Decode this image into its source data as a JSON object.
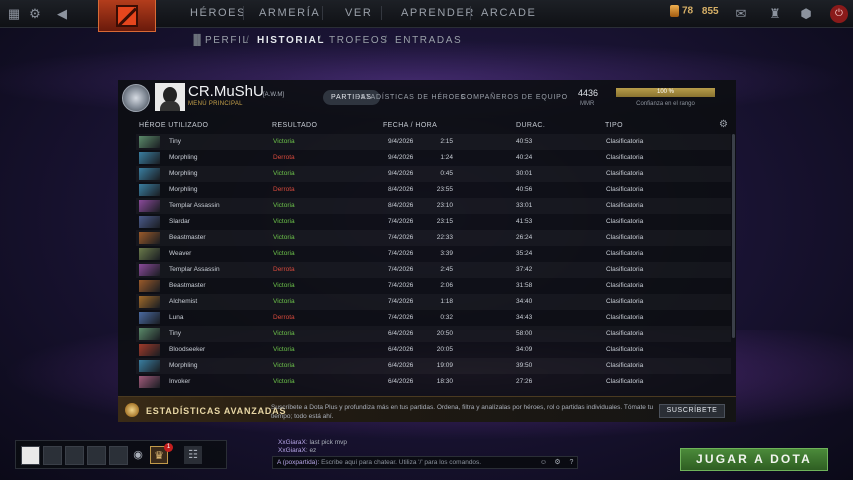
{
  "topbar": {
    "nav": [
      "HÉROES",
      "ARMERÍA",
      "VER",
      "APRENDER",
      "ARCADE"
    ],
    "shards": "78",
    "shards2": "855"
  },
  "subnav": {
    "items": [
      "PERFIL",
      "HISTORIAL",
      "TROFEOS",
      "ENTRADAS"
    ],
    "active": 1
  },
  "profile": {
    "name": "CR.MuShU",
    "tag": "[A.W.M]",
    "subtitle": "MENÚ PRINCIPAL",
    "tabs": [
      "PARTIDAS",
      "ESTADÍSTICAS DE HÉROES",
      "COMPAÑEROS DE EQUIPO"
    ],
    "active_tab": 0,
    "mmr_value": "4436",
    "mmr_label": "MMR",
    "confidence_pct": "100 %",
    "confidence_fraction": 1.0,
    "confidence_label": "Confianza en el rango"
  },
  "table": {
    "headers": [
      "HÉROE UTILIZADO",
      "RESULTADO",
      "FECHA / HORA",
      "DURAC.",
      "TIPO"
    ],
    "rows": [
      {
        "hero": "Tiny",
        "result": "Victoria",
        "win": true,
        "date": "9/4/2026",
        "time": "2:15",
        "duration": "40:53",
        "type": "Clasificatoria",
        "color": "#5b8a6a"
      },
      {
        "hero": "Morphling",
        "result": "Derrota",
        "win": false,
        "date": "9/4/2026",
        "time": "1:24",
        "duration": "40:24",
        "type": "Clasificatoria",
        "color": "#3a7ea0"
      },
      {
        "hero": "Morphling",
        "result": "Victoria",
        "win": true,
        "date": "9/4/2026",
        "time": "0:45",
        "duration": "30:01",
        "type": "Clasificatoria",
        "color": "#3a7ea0"
      },
      {
        "hero": "Morphling",
        "result": "Derrota",
        "win": false,
        "date": "8/4/2026",
        "time": "23:55",
        "duration": "40:56",
        "type": "Clasificatoria",
        "color": "#3a7ea0"
      },
      {
        "hero": "Templar Assassin",
        "result": "Victoria",
        "win": true,
        "date": "8/4/2026",
        "time": "23:10",
        "duration": "33:01",
        "type": "Clasificatoria",
        "color": "#8a4a9a"
      },
      {
        "hero": "Slardar",
        "result": "Victoria",
        "win": true,
        "date": "7/4/2026",
        "time": "23:15",
        "duration": "41:53",
        "type": "Clasificatoria",
        "color": "#4a5a8a"
      },
      {
        "hero": "Beastmaster",
        "result": "Victoria",
        "win": true,
        "date": "7/4/2026",
        "time": "22:33",
        "duration": "26:24",
        "type": "Clasificatoria",
        "color": "#9a5a2a"
      },
      {
        "hero": "Weaver",
        "result": "Victoria",
        "win": true,
        "date": "7/4/2026",
        "time": "3:39",
        "duration": "35:24",
        "type": "Clasificatoria",
        "color": "#6a7a4a"
      },
      {
        "hero": "Templar Assassin",
        "result": "Derrota",
        "win": false,
        "date": "7/4/2026",
        "time": "2:45",
        "duration": "37:42",
        "type": "Clasificatoria",
        "color": "#8a4a9a"
      },
      {
        "hero": "Beastmaster",
        "result": "Victoria",
        "win": true,
        "date": "7/4/2026",
        "time": "2:06",
        "duration": "31:58",
        "type": "Clasificatoria",
        "color": "#9a5a2a"
      },
      {
        "hero": "Alchemist",
        "result": "Victoria",
        "win": true,
        "date": "7/4/2026",
        "time": "1:18",
        "duration": "34:40",
        "type": "Clasificatoria",
        "color": "#a06a2a"
      },
      {
        "hero": "Luna",
        "result": "Derrota",
        "win": false,
        "date": "7/4/2026",
        "time": "0:32",
        "duration": "34:43",
        "type": "Clasificatoria",
        "color": "#4a6aa0"
      },
      {
        "hero": "Tiny",
        "result": "Victoria",
        "win": true,
        "date": "6/4/2026",
        "time": "20:50",
        "duration": "58:00",
        "type": "Clasificatoria",
        "color": "#5b8a6a"
      },
      {
        "hero": "Bloodseeker",
        "result": "Victoria",
        "win": true,
        "date": "6/4/2026",
        "time": "20:05",
        "duration": "34:09",
        "type": "Clasificatoria",
        "color": "#a03a2a"
      },
      {
        "hero": "Morphling",
        "result": "Victoria",
        "win": true,
        "date": "6/4/2026",
        "time": "19:09",
        "duration": "39:50",
        "type": "Clasificatoria",
        "color": "#3a7ea0"
      },
      {
        "hero": "Invoker",
        "result": "Victoria",
        "win": true,
        "date": "6/4/2026",
        "time": "18:30",
        "duration": "27:26",
        "type": "Clasificatoria",
        "color": "#a05a7a"
      }
    ]
  },
  "plus": {
    "title": "ESTADÍSTICAS AVANZADAS",
    "description": "Suscríbete a Dota Plus y profundiza más en tus partidas. Ordena, filtra y analízalas por héroes, rol o partidas individuales. Tómate tu tiempo; todo está ahí.",
    "button": "SUSCRÍBETE"
  },
  "chat": {
    "lines": [
      {
        "name": "XxGiaraX",
        "msg": ": last pick mvp"
      },
      {
        "name": "XxGiaraX",
        "msg": ": ez"
      }
    ],
    "channel": "A (poxpartida):",
    "placeholder": "Escribe aquí para chatear. Utiliza '/' para los comandos."
  },
  "notifications": "1",
  "play_button": "JUGAR A DOTA"
}
